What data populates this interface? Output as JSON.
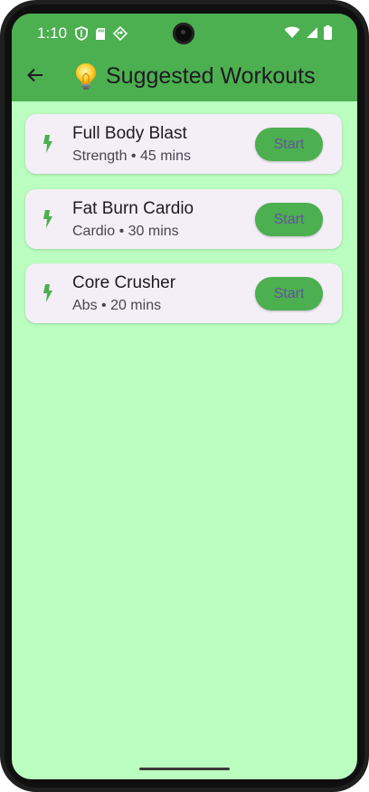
{
  "status_bar": {
    "time": "1:10",
    "left_icons": [
      "shield-icon",
      "sd-card-icon",
      "location-icon"
    ],
    "right_icons": [
      "wifi-icon",
      "signal-icon",
      "battery-icon"
    ]
  },
  "app_bar": {
    "title": "Suggested Workouts",
    "title_emoji_icon": "lightbulb-icon",
    "back_icon": "back-arrow-icon",
    "color": "#4caf50"
  },
  "workouts": [
    {
      "name": "Full Body Blast",
      "meta": "Strength • 45 mins",
      "action": "Start",
      "icon": "bolt-icon"
    },
    {
      "name": "Fat Burn Cardio",
      "meta": "Cardio • 30 mins",
      "action": "Start",
      "icon": "bolt-icon"
    },
    {
      "name": "Core Crusher",
      "meta": "Abs • 20 mins",
      "action": "Start",
      "icon": "bolt-icon"
    }
  ],
  "colors": {
    "background": "#baffc0",
    "primary": "#4caf50",
    "card": "#f4eff7",
    "button_text": "#6750a4"
  }
}
